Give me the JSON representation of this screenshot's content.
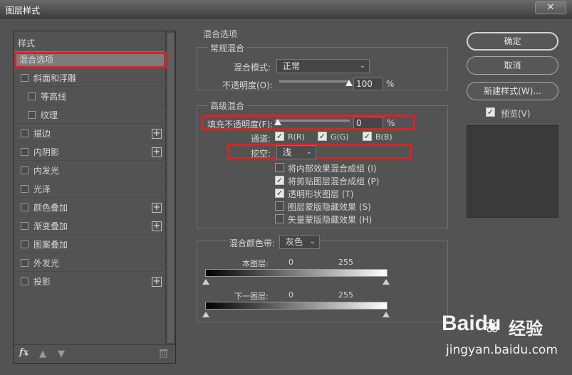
{
  "window": {
    "title": "图层样式",
    "close_glyph": "✕"
  },
  "style_list": {
    "header": "样式",
    "items": [
      {
        "label": "混合选项",
        "checkbox": false,
        "plus": false,
        "indent": 0,
        "selected": true
      },
      {
        "label": "斜面和浮雕",
        "checkbox": true,
        "plus": false,
        "indent": 0
      },
      {
        "label": "等高线",
        "checkbox": true,
        "plus": false,
        "indent": 1
      },
      {
        "label": "纹理",
        "checkbox": true,
        "plus": false,
        "indent": 1
      },
      {
        "label": "描边",
        "checkbox": true,
        "plus": true,
        "indent": 0
      },
      {
        "label": "内阴影",
        "checkbox": true,
        "plus": true,
        "indent": 0
      },
      {
        "label": "内发光",
        "checkbox": true,
        "plus": false,
        "indent": 0
      },
      {
        "label": "光泽",
        "checkbox": true,
        "plus": false,
        "indent": 0
      },
      {
        "label": "颜色叠加",
        "checkbox": true,
        "plus": true,
        "indent": 0
      },
      {
        "label": "渐变叠加",
        "checkbox": true,
        "plus": true,
        "indent": 0
      },
      {
        "label": "图案叠加",
        "checkbox": true,
        "plus": false,
        "indent": 0
      },
      {
        "label": "外发光",
        "checkbox": true,
        "plus": false,
        "indent": 0
      },
      {
        "label": "投影",
        "checkbox": true,
        "plus": true,
        "indent": 0
      }
    ],
    "toolbar": {
      "fx": "fx",
      "up_icon": "arrow-up-icon",
      "down_icon": "arrow-down-icon",
      "trash_icon": "trash-icon"
    }
  },
  "blend_options": {
    "section_title": "混合选项",
    "general": {
      "title": "常规混合",
      "mode_label": "混合模式:",
      "mode_value": "正常",
      "opacity_label": "不透明度(O):",
      "opacity_value": "100",
      "opacity_fraction": 1.0,
      "percent": "%"
    },
    "advanced": {
      "title": "高级混合",
      "fill_label": "填充不透明度(F):",
      "fill_value": "0",
      "fill_fraction": 0.0,
      "percent": "%",
      "channels_label": "通道:",
      "channels": [
        {
          "label": "R(R)",
          "checked": true
        },
        {
          "label": "G(G)",
          "checked": true
        },
        {
          "label": "B(B)",
          "checked": true
        }
      ],
      "knockout_label": "挖空:",
      "knockout_value": "浅",
      "options": [
        {
          "label": "将内部效果混合成组 (I)",
          "checked": false
        },
        {
          "label": "将剪贴图层混合成组 (P)",
          "checked": true
        },
        {
          "label": "透明形状图层 (T)",
          "checked": true
        },
        {
          "label": "图层蒙版隐藏效果 (S)",
          "checked": false
        },
        {
          "label": "矢量蒙版隐藏效果 (H)",
          "checked": false
        }
      ]
    },
    "blend_if": {
      "label": "混合颜色带:",
      "value": "灰色",
      "this_layer_label": "本图层:",
      "this_layer_min": "0",
      "this_layer_max": "255",
      "underlying_label": "下一图层:",
      "underlying_min": "0",
      "underlying_max": "255"
    }
  },
  "buttons": {
    "ok": "确定",
    "cancel": "取消",
    "new_style": "新建样式(W)...",
    "preview_label": "预览(V)",
    "preview_checked": true
  },
  "watermark": {
    "brand": "Baidu",
    "brand_cn": "经验",
    "url": "jingyan.baidu.com"
  },
  "colors": {
    "background": "#535353",
    "highlight_box": "#d8232a",
    "selected_row": "#7c7c7c"
  }
}
